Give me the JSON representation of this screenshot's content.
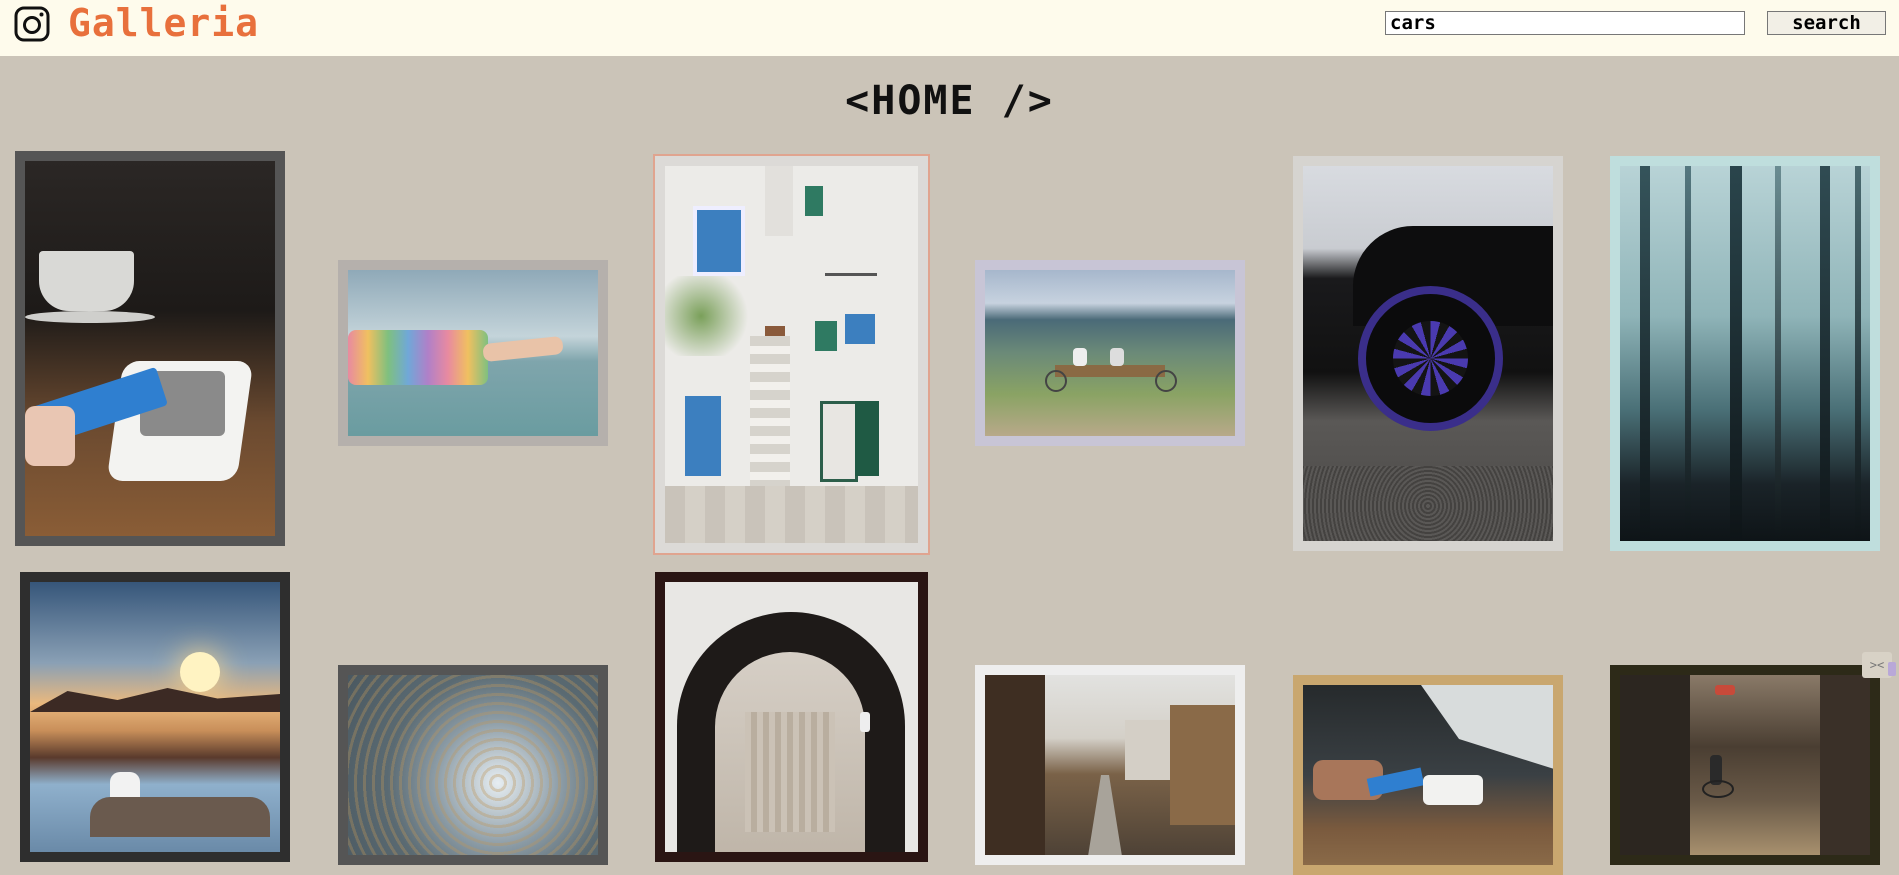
{
  "header": {
    "brand": "Galleria",
    "logo_icon": "instagram-camera-icon",
    "search_value": "cars",
    "search_button": "search"
  },
  "page": {
    "title": "<HOME />"
  },
  "colors": {
    "header_bg": "#fefbec",
    "brand": "#e8703c",
    "page_bg": "#cbc4b8"
  },
  "gallery": [
    {
      "subject": "card payment terminal with coffee cup",
      "frame": "#555555"
    },
    {
      "subject": "hand in rainbow knit sleeve over sea",
      "frame": "#b5b0ac"
    },
    {
      "subject": "white house with blue doors and stairs",
      "frame": "#e0a48f"
    },
    {
      "subject": "two people on bench overlooking hills",
      "frame": "#c8c5d6"
    },
    {
      "subject": "black sports car purple wheel",
      "frame": "#d6d4d0"
    },
    {
      "subject": "misty forest trees",
      "frame": "#bfdedd"
    },
    {
      "subject": "man sitting above clouds at sunset",
      "frame": "#2e2e2e"
    },
    {
      "subject": "aerial snowy forest",
      "frame": "#555555"
    },
    {
      "subject": "dark archway interior",
      "frame": "#2a1513"
    },
    {
      "subject": "japanese street with old houses",
      "frame": "#eeeeee"
    },
    {
      "subject": "hand with card at payment reader",
      "frame": "#c9a76f"
    },
    {
      "subject": "narrow alley with cyclist",
      "frame": "#2d2a18"
    }
  ]
}
